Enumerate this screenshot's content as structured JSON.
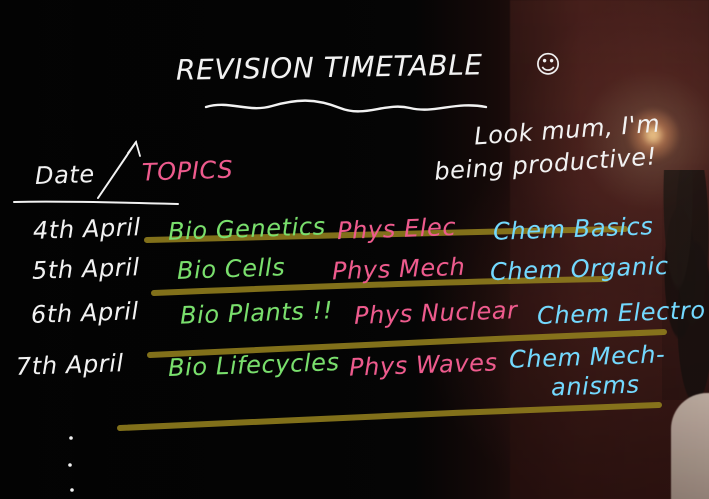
{
  "colors": {
    "white": "#f2f2f2",
    "pink": "#ef5a8d",
    "green": "#79e06c",
    "cyan": "#72d9ff",
    "underline": "#8f7c1d",
    "background_left": "#050505",
    "background_right": "#3d1a17"
  },
  "board": {
    "title": "REVISION TIMETABLE",
    "smiley": "☺",
    "note_line_1": "Look mum, I'm",
    "note_line_2": "being productive!",
    "header_date": "Date",
    "header_topics": "TOPICS"
  },
  "rows": [
    {
      "date": "4th April",
      "bio": "Bio Genetics",
      "phys": "Phys Elec",
      "chem": "Chem Basics"
    },
    {
      "date": "5th April",
      "bio": "Bio Cells",
      "phys": "Phys Mech",
      "chem": "Chem Organic"
    },
    {
      "date": "6th April",
      "bio": "Bio Plants !!",
      "phys": "Phys Nuclear",
      "chem": "Chem Electro"
    },
    {
      "date": "7th April",
      "bio": "Bio Lifecycles",
      "phys": "Phys Waves",
      "chem_line_1": "Chem Mech-",
      "chem_line_2": "anisms"
    }
  ]
}
